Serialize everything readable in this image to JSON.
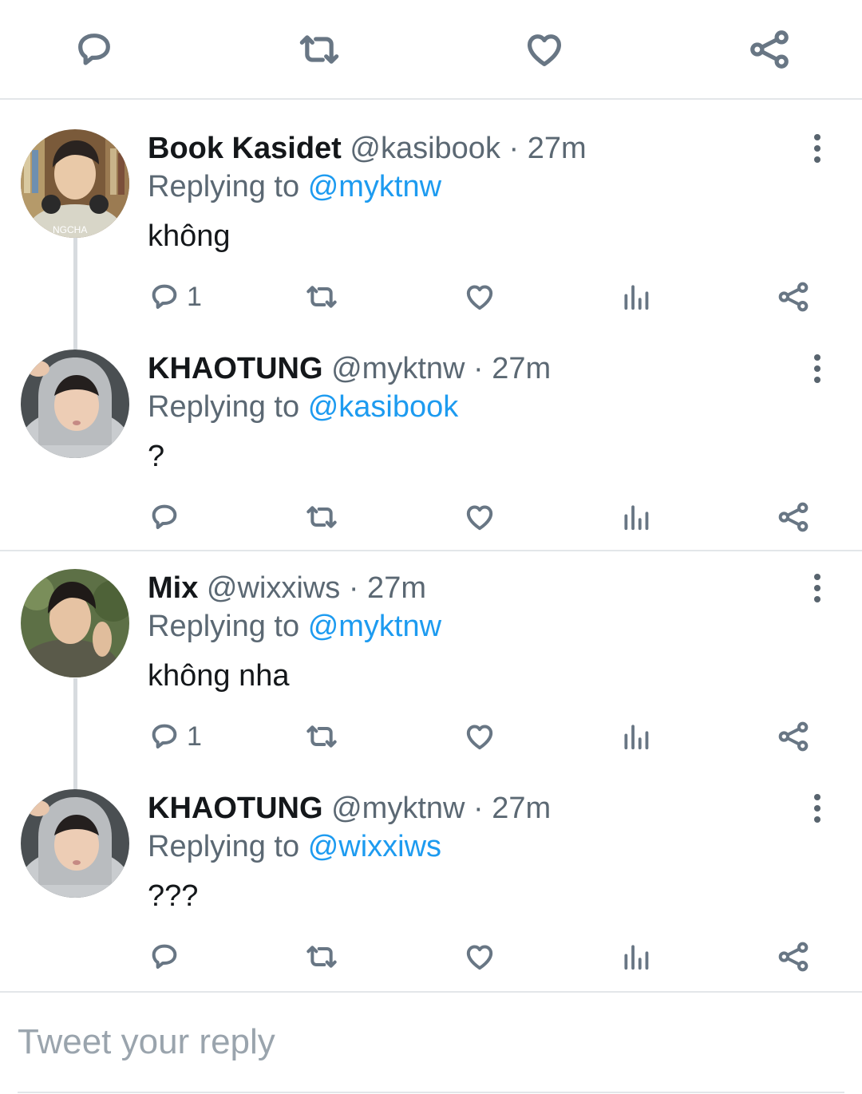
{
  "top_actions": [
    "reply-icon",
    "retweet-icon",
    "like-icon",
    "share-icon"
  ],
  "tweets": [
    {
      "name": "Book Kasidet",
      "handle": "@kasibook",
      "time": "· 27m",
      "replying_prefix": "Replying to",
      "replying_to": "@myktnw",
      "text": "không",
      "reply_count": "1"
    },
    {
      "name": "KHAOTUNG",
      "handle": "@myktnw",
      "time": "· 27m",
      "replying_prefix": "Replying to",
      "replying_to": "@kasibook",
      "text": "?",
      "reply_count": ""
    },
    {
      "name": "Mix",
      "handle": "@wixxiws",
      "time": "· 27m",
      "replying_prefix": "Replying to",
      "replying_to": "@myktnw",
      "text": "không nha",
      "reply_count": "1"
    },
    {
      "name": "KHAOTUNG",
      "handle": "@myktnw",
      "time": "· 27m",
      "replying_prefix": "Replying to",
      "replying_to": "@wixxiws",
      "text": "???",
      "reply_count": ""
    }
  ],
  "composer": {
    "placeholder": "Tweet your reply"
  },
  "colors": {
    "mention": "#1d9bf0",
    "icon": "#687684",
    "divider": "#e3e6e9"
  }
}
